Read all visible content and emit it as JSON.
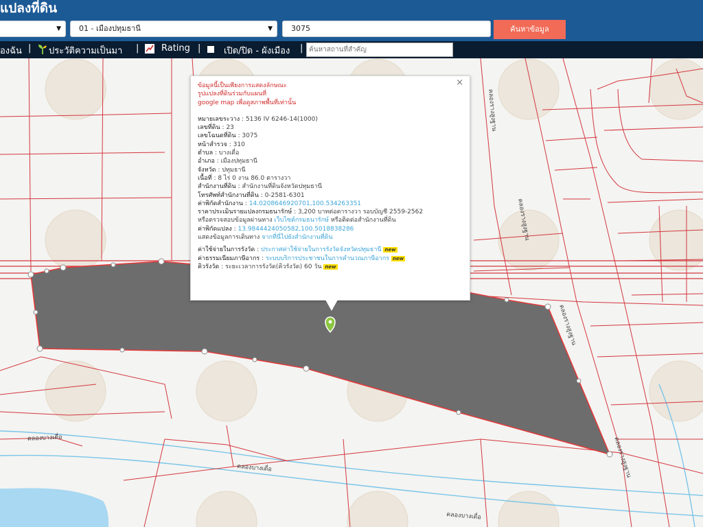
{
  "header": {
    "title": "แปลงที่ดิน",
    "amphoe_select": "01 - เมืองปทุมธานี",
    "parcel_input": "3075",
    "search_button": "ค้นหาข้อมูล"
  },
  "toolbar": {
    "item1": "องฉัน",
    "sep": "|",
    "item2": "ประวัติความเป็นมา",
    "item3": "Rating",
    "item4": "เปิด/ปิด - ผังเมือง",
    "place_placeholder": "ค้นหาสถานที่สำคัญ"
  },
  "popup": {
    "warning_1": "ข้อมูลนี้เป็นเพียงการแสดงลักษณะ",
    "warning_2": "รูปแปลงที่ดินร่วมกับแผนที่",
    "warning_3": "google map เพื่อดูสภาพพื้นที่เท่านั้น",
    "map_sheet_label": "หมายเลขระวาง",
    "map_sheet_value": "5136 IV 6246-14(1000)",
    "land_no_label": "เลขที่ดิน",
    "land_no_value": "23",
    "deed_label": "เลขโฉนดที่ดิน",
    "deed_value": "3075",
    "survey_label": "หน้าสำรวจ",
    "survey_value": "310",
    "tambon_label": "ตำบล",
    "tambon_value": "บางเดื่อ",
    "amphoe_label": "อำเภอ",
    "amphoe_value": "เมืองปทุมธานี",
    "province_label": "จังหวัด",
    "province_value": "ปทุมธานี",
    "area_label": "เนื้อที่",
    "area_value": "8 ไร่ 0 งาน 86.0 ตารางวา",
    "office_label": "สำนักงานที่ดิน",
    "office_value": "สำนักงานที่ดินจังหวัดปทุมธานี",
    "phone_label": "โทรศัพท์สำนักงานที่ดิน",
    "phone_value": "0-2581-6301",
    "office_coord_label": "ค่าพิกัดสำนักงาน",
    "office_coord_value": "14.0208646920701,100.534263351",
    "price_label": "ราคาประเมินรายแปลงกรมธนารักษ์",
    "price_value": "3,200 บาทต่อตารางวา รอบบัญชี 2559-2562",
    "verify_prefix": "หรือตรวจสอบข้อมูลผ่านทาง",
    "verify_link": "เว็บไซต์กรมธนารักษ์",
    "verify_suffix": "หรือติดต่อสำนักงานที่ดิน",
    "parcel_coord_label": "ค่าพิกัดแปลง",
    "parcel_coord_value": "13.9844424050582,100.5018838286",
    "route_prefix": "แสดงข้อมูลการเดินทาง",
    "route_link": "จากที่นี่ไปยังสำนักงานที่ดิน",
    "fee_label": "ค่าใช้จ่ายในการรังวัด",
    "fee_link": "ประกาศค่าใช้จ่ายในการรังวัดจังหวัดปทุมธานี",
    "tax_label": "ค่าธรรมเนียมภาษีอากร",
    "tax_link": "ระบบบริการประชาชนในการคำนวณภาษีอากร",
    "queue_label": "คิวรังวัด",
    "queue_value": "ระยะเวลาการรังวัด(คิวรังวัด) 60 วัน",
    "new_badge": "new",
    "close": "×"
  },
  "map": {
    "road_labels": [
      "คลองรางสูงฐาน",
      "คลองรางสูงฐาน",
      "คลองรางสูงฐาน",
      "คลองรางสูงฐาน"
    ],
    "canal_labels": [
      "คลองบางเดื่อ",
      "คลองบางเดื่อ",
      "คลองบางเดื่อ"
    ],
    "colors": {
      "parcel_fill": "#6d6d6d",
      "parcel_border": "#e23b3b",
      "boundary_lines": "#d4363e",
      "canal": "#7ac5e8",
      "water": "#a8d8f2",
      "popup_warning": "#d02b2b",
      "popup_link": "#3ca4d8",
      "marker": "#8cc540"
    }
  },
  "icons": {
    "sprout": "sprout-icon",
    "rating": "rating-chart-icon",
    "layer": "square-icon",
    "close": "close-icon",
    "marker": "map-pin-icon"
  }
}
